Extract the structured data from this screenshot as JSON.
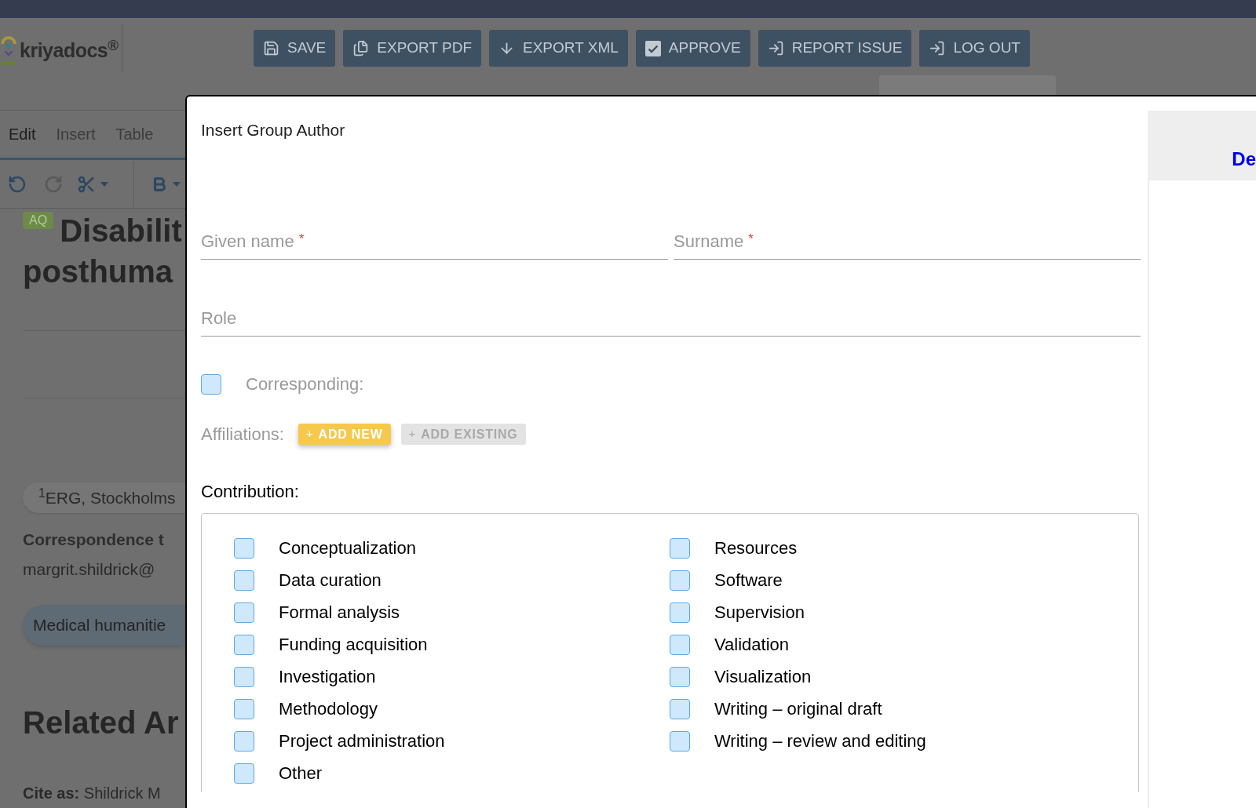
{
  "header": {
    "logo": "kriyadocs$^{®}$",
    "buttons": [
      "SAVE",
      "EXPORT PDF",
      "EXPORT XML",
      "APPROVE",
      "REPORT ISSUE",
      "LOG OUT"
    ]
  },
  "menu": [
    {
      "label": "Edit",
      "selected": true
    },
    {
      "label": "Insert",
      "selected": false
    },
    {
      "label": "Table",
      "selected": false
    }
  ],
  "editor_toolbar": [
    {
      "disabled": false
    },
    {
      "disabled": true
    },
    {
      "disabled": false
    },
    {
      "disabled": false
    }
  ],
  "article": {
    "badge": "AQ",
    "title_lines": [
      "Disabilit",
      "posthuma"
    ],
    "affiliation": "$^{1}$ERG, Stockholms",
    "correspondence": "Correspondence t",
    "email": "margrit.shildrick@",
    "subject_tag": "Medical humanitie",
    "related_heading": "Related Ar",
    "citation": "**Cite as:** Shildrick M"
  },
  "dialog": {
    "title": "Insert Group Author",
    "name_fields": [
      {
        "label": "Given name",
        "required_mark": "*"
      },
      {
        "label": "Surname",
        "required_mark": "*"
      }
    ],
    "role_field": {
      "label": "Role"
    },
    "corresponding": {
      "label": "Corresponding:",
      "checked": false
    },
    "affiliations": {
      "label": "Affiliations:",
      "buttons": [
        {
          "icon": "+",
          "label": "ADD NEW",
          "disabled": false
        },
        {
          "icon": "+",
          "label": "ADD EXISTING",
          "disabled": true
        }
      ]
    },
    "contribution": {
      "label": "Contribution:",
      "columns": [
        {
          "items": [
            {
              "label": "Conceptualization",
              "checked": false
            },
            {
              "label": "Data curation",
              "checked": false
            },
            {
              "label": "Formal analysis",
              "checked": false
            },
            {
              "label": "Funding acquisition",
              "checked": false
            },
            {
              "label": "Investigation",
              "checked": false
            },
            {
              "label": "Methodology",
              "checked": false
            },
            {
              "label": "Project administration",
              "checked": false
            },
            {
              "label": "Other",
              "checked": false
            }
          ]
        },
        {
          "items": [
            {
              "label": "Resources",
              "checked": false
            },
            {
              "label": "Software",
              "checked": false
            },
            {
              "label": "Supervision",
              "checked": false
            },
            {
              "label": "Validation",
              "checked": false
            },
            {
              "label": "Visualization",
              "checked": false
            },
            {
              "label": "Writing – original draft",
              "checked": false
            },
            {
              "label": "Writing – review and editing",
              "checked": false
            }
          ]
        }
      ]
    }
  },
  "preview": {
    "heading": "De"
  }
}
